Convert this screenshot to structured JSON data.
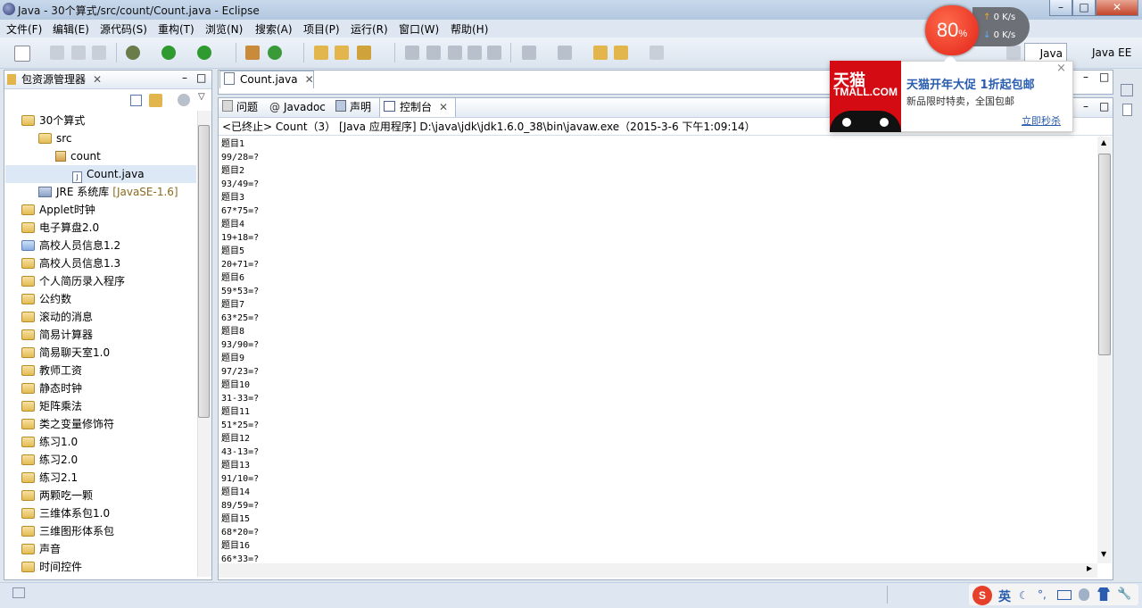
{
  "window": {
    "title": "Java  -  30个算式/src/count/Count.java  -  Eclipse"
  },
  "menu": [
    "文件(F)",
    "编辑(E)",
    "源代码(S)",
    "重构(T)",
    "浏览(N)",
    "搜索(A)",
    "项目(P)",
    "运行(R)",
    "窗口(W)",
    "帮助(H)"
  ],
  "perspectives": {
    "java": "Java",
    "javaee": "Java EE"
  },
  "package_explorer": {
    "tab_label": "包资源管理器",
    "tree": [
      {
        "label": "30个算式",
        "level": 0,
        "icon": "project-folder-icon"
      },
      {
        "label": "src",
        "level": 1,
        "icon": "source-folder-icon"
      },
      {
        "label": "count",
        "level": 2,
        "icon": "package-icon"
      },
      {
        "label": "Count.java",
        "level": 3,
        "icon": "java-file-icon"
      },
      {
        "label": "JRE 系统库",
        "level": 1,
        "icon": "library-icon",
        "suffix": "[JavaSE-1.6]"
      },
      {
        "label": "Applet时钟",
        "level": 0,
        "icon": "project-folder-icon"
      },
      {
        "label": "电子算盘2.0",
        "level": 0,
        "icon": "project-folder-icon"
      },
      {
        "label": "高校人员信息1.2",
        "level": 0,
        "icon": "closed-project-icon"
      },
      {
        "label": "高校人员信息1.3",
        "level": 0,
        "icon": "project-folder-icon"
      },
      {
        "label": "个人简历录入程序",
        "level": 0,
        "icon": "project-folder-icon"
      },
      {
        "label": "公约数",
        "level": 0,
        "icon": "project-folder-icon"
      },
      {
        "label": "滚动的消息",
        "level": 0,
        "icon": "project-folder-icon"
      },
      {
        "label": "简易计算器",
        "level": 0,
        "icon": "project-folder-icon"
      },
      {
        "label": "简易聊天室1.0",
        "level": 0,
        "icon": "project-folder-icon"
      },
      {
        "label": "教师工资",
        "level": 0,
        "icon": "project-folder-icon"
      },
      {
        "label": "静态时钟",
        "level": 0,
        "icon": "project-folder-icon"
      },
      {
        "label": "矩阵乘法",
        "level": 0,
        "icon": "project-folder-icon"
      },
      {
        "label": "类之变量修饰符",
        "level": 0,
        "icon": "project-folder-icon"
      },
      {
        "label": "练习1.0",
        "level": 0,
        "icon": "project-folder-icon"
      },
      {
        "label": "练习2.0",
        "level": 0,
        "icon": "project-folder-icon"
      },
      {
        "label": "练习2.1",
        "level": 0,
        "icon": "project-folder-icon"
      },
      {
        "label": "两颗吃一颗",
        "level": 0,
        "icon": "project-folder-icon"
      },
      {
        "label": "三维体系包1.0",
        "level": 0,
        "icon": "project-folder-icon"
      },
      {
        "label": "三维图形体系包",
        "level": 0,
        "icon": "project-folder-icon"
      },
      {
        "label": "声音",
        "level": 0,
        "icon": "project-folder-icon"
      },
      {
        "label": "时间控件",
        "level": 0,
        "icon": "project-folder-icon"
      }
    ]
  },
  "editor": {
    "tab_label": "Count.java"
  },
  "console_view": {
    "tabs": [
      "问题",
      "Javadoc",
      "声明",
      "控制台"
    ],
    "header": "<已终止> Count（3） [Java 应用程序] D:\\java\\jdk\\jdk1.6.0_38\\bin\\javaw.exe（2015-3-6 下午1:09:14）",
    "lines": [
      "题目1",
      "99/28=?",
      "题目2",
      "93/49=?",
      "题目3",
      "67*75=?",
      "题目4",
      "19+18=?",
      "题目5",
      "20+71=?",
      "题目6",
      "59*53=?",
      "题目7",
      "63*25=?",
      "题目8",
      "93/90=?",
      "题目9",
      "97/23=?",
      "题目10",
      "31-33=?",
      "题目11",
      "51*25=?",
      "题目12",
      "43-13=?",
      "题目13",
      "91/10=?",
      "题目14",
      "89/59=?",
      "题目15",
      "68*20=?",
      "题目16",
      "66*33=?"
    ]
  },
  "popup": {
    "logo_cn": "天猫",
    "logo_en": "TMALL.COM",
    "title": "天猫开年大促 1折起包邮",
    "subtitle": "新品限时特卖，全国包邮",
    "link": "立即秒杀",
    "close": "×"
  },
  "speed_widget": {
    "percent": "80",
    "percent_sign": "%",
    "up": "0 K/s",
    "down": "0 K/s"
  },
  "ime": {
    "mode": "英",
    "logo": "S"
  },
  "colors": {
    "accent": "#2a5db0",
    "tmall_red": "#d50b13",
    "ball_red": "#e12218"
  }
}
